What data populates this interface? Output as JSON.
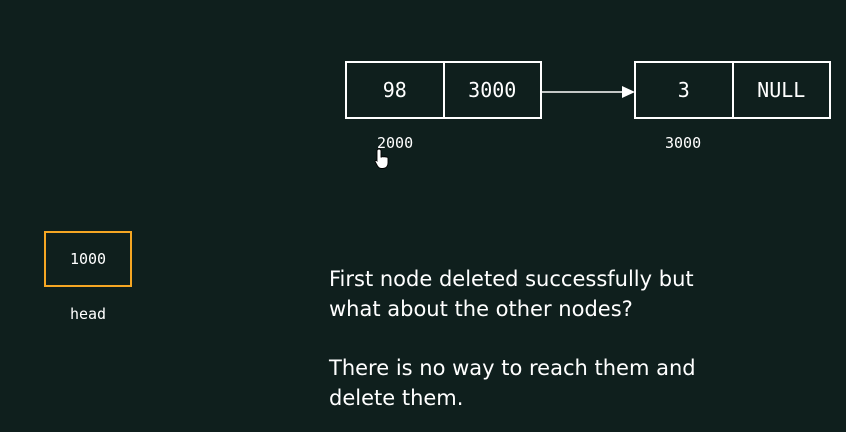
{
  "nodes": [
    {
      "data": "98",
      "next": "3000",
      "address": "2000"
    },
    {
      "data": "3",
      "next": "NULL",
      "address": "3000"
    }
  ],
  "head": {
    "value": "1000",
    "label": "head"
  },
  "message": {
    "line1": "First node deleted successfully but",
    "line2": "what about the other nodes?",
    "line3": "There is no way to reach them and",
    "line4": "delete them."
  },
  "colors": {
    "background": "#0f1f1d",
    "node_border": "#ffffff",
    "head_border": "#f5a623"
  },
  "icons": {
    "arrow": "arrow-right-icon",
    "cursor": "hand-pointer-icon"
  }
}
